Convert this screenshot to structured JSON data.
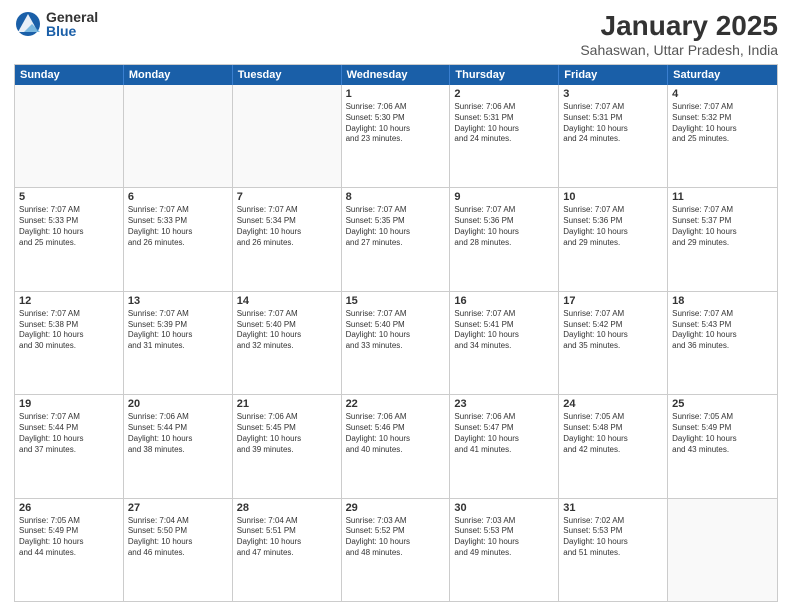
{
  "logo": {
    "general": "General",
    "blue": "Blue"
  },
  "title": "January 2025",
  "location": "Sahaswan, Uttar Pradesh, India",
  "days": [
    "Sunday",
    "Monday",
    "Tuesday",
    "Wednesday",
    "Thursday",
    "Friday",
    "Saturday"
  ],
  "weeks": [
    [
      {
        "day": "",
        "info": ""
      },
      {
        "day": "",
        "info": ""
      },
      {
        "day": "",
        "info": ""
      },
      {
        "day": "1",
        "info": "Sunrise: 7:06 AM\nSunset: 5:30 PM\nDaylight: 10 hours\nand 23 minutes."
      },
      {
        "day": "2",
        "info": "Sunrise: 7:06 AM\nSunset: 5:31 PM\nDaylight: 10 hours\nand 24 minutes."
      },
      {
        "day": "3",
        "info": "Sunrise: 7:07 AM\nSunset: 5:31 PM\nDaylight: 10 hours\nand 24 minutes."
      },
      {
        "day": "4",
        "info": "Sunrise: 7:07 AM\nSunset: 5:32 PM\nDaylight: 10 hours\nand 25 minutes."
      }
    ],
    [
      {
        "day": "5",
        "info": "Sunrise: 7:07 AM\nSunset: 5:33 PM\nDaylight: 10 hours\nand 25 minutes."
      },
      {
        "day": "6",
        "info": "Sunrise: 7:07 AM\nSunset: 5:33 PM\nDaylight: 10 hours\nand 26 minutes."
      },
      {
        "day": "7",
        "info": "Sunrise: 7:07 AM\nSunset: 5:34 PM\nDaylight: 10 hours\nand 26 minutes."
      },
      {
        "day": "8",
        "info": "Sunrise: 7:07 AM\nSunset: 5:35 PM\nDaylight: 10 hours\nand 27 minutes."
      },
      {
        "day": "9",
        "info": "Sunrise: 7:07 AM\nSunset: 5:36 PM\nDaylight: 10 hours\nand 28 minutes."
      },
      {
        "day": "10",
        "info": "Sunrise: 7:07 AM\nSunset: 5:36 PM\nDaylight: 10 hours\nand 29 minutes."
      },
      {
        "day": "11",
        "info": "Sunrise: 7:07 AM\nSunset: 5:37 PM\nDaylight: 10 hours\nand 29 minutes."
      }
    ],
    [
      {
        "day": "12",
        "info": "Sunrise: 7:07 AM\nSunset: 5:38 PM\nDaylight: 10 hours\nand 30 minutes."
      },
      {
        "day": "13",
        "info": "Sunrise: 7:07 AM\nSunset: 5:39 PM\nDaylight: 10 hours\nand 31 minutes."
      },
      {
        "day": "14",
        "info": "Sunrise: 7:07 AM\nSunset: 5:40 PM\nDaylight: 10 hours\nand 32 minutes."
      },
      {
        "day": "15",
        "info": "Sunrise: 7:07 AM\nSunset: 5:40 PM\nDaylight: 10 hours\nand 33 minutes."
      },
      {
        "day": "16",
        "info": "Sunrise: 7:07 AM\nSunset: 5:41 PM\nDaylight: 10 hours\nand 34 minutes."
      },
      {
        "day": "17",
        "info": "Sunrise: 7:07 AM\nSunset: 5:42 PM\nDaylight: 10 hours\nand 35 minutes."
      },
      {
        "day": "18",
        "info": "Sunrise: 7:07 AM\nSunset: 5:43 PM\nDaylight: 10 hours\nand 36 minutes."
      }
    ],
    [
      {
        "day": "19",
        "info": "Sunrise: 7:07 AM\nSunset: 5:44 PM\nDaylight: 10 hours\nand 37 minutes."
      },
      {
        "day": "20",
        "info": "Sunrise: 7:06 AM\nSunset: 5:44 PM\nDaylight: 10 hours\nand 38 minutes."
      },
      {
        "day": "21",
        "info": "Sunrise: 7:06 AM\nSunset: 5:45 PM\nDaylight: 10 hours\nand 39 minutes."
      },
      {
        "day": "22",
        "info": "Sunrise: 7:06 AM\nSunset: 5:46 PM\nDaylight: 10 hours\nand 40 minutes."
      },
      {
        "day": "23",
        "info": "Sunrise: 7:06 AM\nSunset: 5:47 PM\nDaylight: 10 hours\nand 41 minutes."
      },
      {
        "day": "24",
        "info": "Sunrise: 7:05 AM\nSunset: 5:48 PM\nDaylight: 10 hours\nand 42 minutes."
      },
      {
        "day": "25",
        "info": "Sunrise: 7:05 AM\nSunset: 5:49 PM\nDaylight: 10 hours\nand 43 minutes."
      }
    ],
    [
      {
        "day": "26",
        "info": "Sunrise: 7:05 AM\nSunset: 5:49 PM\nDaylight: 10 hours\nand 44 minutes."
      },
      {
        "day": "27",
        "info": "Sunrise: 7:04 AM\nSunset: 5:50 PM\nDaylight: 10 hours\nand 46 minutes."
      },
      {
        "day": "28",
        "info": "Sunrise: 7:04 AM\nSunset: 5:51 PM\nDaylight: 10 hours\nand 47 minutes."
      },
      {
        "day": "29",
        "info": "Sunrise: 7:03 AM\nSunset: 5:52 PM\nDaylight: 10 hours\nand 48 minutes."
      },
      {
        "day": "30",
        "info": "Sunrise: 7:03 AM\nSunset: 5:53 PM\nDaylight: 10 hours\nand 49 minutes."
      },
      {
        "day": "31",
        "info": "Sunrise: 7:02 AM\nSunset: 5:53 PM\nDaylight: 10 hours\nand 51 minutes."
      },
      {
        "day": "",
        "info": ""
      }
    ]
  ]
}
